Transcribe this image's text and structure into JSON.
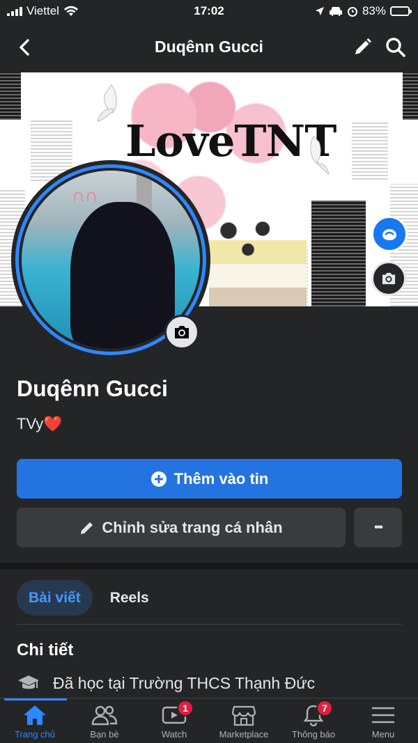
{
  "status_bar": {
    "carrier": "Viettel",
    "time": "17:02",
    "battery_percent": "83%",
    "battery_level": 0.83,
    "battery_color": "#ffcc00"
  },
  "header": {
    "title": "Duqênn Gucci",
    "icons": [
      "back-arrow-icon",
      "pencil-icon",
      "search-icon"
    ]
  },
  "cover": {
    "title_text": "LoveTNT"
  },
  "profile": {
    "name": "Duqênn Gucci",
    "bio": "TVy❤️"
  },
  "actions": {
    "add_story_label": "Thêm vào tin",
    "edit_profile_label": "Chỉnh sửa trang cá nhân",
    "more_label": "•••"
  },
  "tabs": [
    {
      "label": "Bài viết",
      "active": true
    },
    {
      "label": "Reels",
      "active": false
    }
  ],
  "details": {
    "title": "Chi tiết",
    "education": "Đã học tại Trường THCS Thạnh Đức"
  },
  "bottom_nav": [
    {
      "label": "Trang chủ",
      "icon": "home-icon",
      "active": true
    },
    {
      "label": "Bạn bè",
      "icon": "friends-icon",
      "active": false
    },
    {
      "label": "Watch",
      "icon": "watch-icon",
      "badge": "1",
      "active": false
    },
    {
      "label": "Marketplace",
      "icon": "marketplace-icon",
      "active": false
    },
    {
      "label": "Thông báo",
      "icon": "bell-icon",
      "badge": "7",
      "active": false
    },
    {
      "label": "Menu",
      "icon": "menu-icon",
      "active": false
    }
  ],
  "colors": {
    "background": "#242526",
    "accent": "#2374e1",
    "badge": "#e41e3f"
  }
}
